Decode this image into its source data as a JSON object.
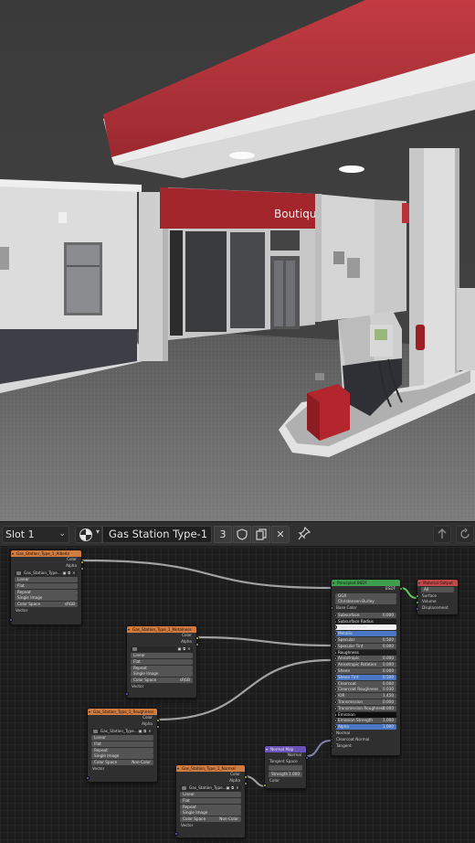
{
  "header": {
    "slot_label": "Slot 1",
    "material_name": "Gas Station Type-1",
    "user_count": "3",
    "chevron": "⌄",
    "browse_chevron": "▾",
    "icons": {
      "material_ball": "material-ball-icon",
      "fake_user": "shield-icon",
      "duplicate": "duplicate-icon",
      "unlink": "close-icon",
      "pin": "pin-icon",
      "parent": "arrow-up-icon",
      "snap": "refresh-icon"
    },
    "unlink_glyph": "✕",
    "pin_glyph": "📌"
  },
  "viewport": {
    "sign_text": "Boutique"
  },
  "nodes": {
    "tex1": {
      "title": "Gas_Station_Type_1_Albedo",
      "image": "Gas_Station_Type...",
      "outputs": [
        "Color",
        "Alpha"
      ],
      "fields": [
        "Linear",
        "Flat",
        "Repeat",
        "Single Image"
      ],
      "colorspace_label": "Color Space",
      "colorspace_value": "sRGB",
      "vector": "Vector"
    },
    "tex2": {
      "title": "Gas_Station_Type_1_Metalness",
      "outputs": [
        "Color",
        "Alpha"
      ],
      "fields": [
        "Linear",
        "Flat",
        "Repeat",
        "Single Image"
      ],
      "colorspace_label": "Color Space",
      "colorspace_value": "sRGB",
      "vector": "Vector"
    },
    "tex3": {
      "title": "Gas_Station_Type_1_Roughness",
      "image": "Gas_Station_Type...",
      "outputs": [
        "Color",
        "Alpha"
      ],
      "fields": [
        "Linear",
        "Flat",
        "Repeat",
        "Single Image"
      ],
      "colorspace_label": "Color Space",
      "colorspace_value": "Non-Color",
      "vector": "Vector"
    },
    "tex4": {
      "title": "Gas_Station_Type_1_Normal",
      "image": "Gas_Station_Type...",
      "outputs": [
        "Color",
        "Alpha"
      ],
      "fields": [
        "Linear",
        "Flat",
        "Repeat",
        "Single Image"
      ],
      "colorspace_label": "Color Space",
      "colorspace_value": "Non-Color",
      "vector": "Vector"
    },
    "normalmap": {
      "title": "Normal Map",
      "output": "Normal",
      "space": "Tangent Space",
      "strength_label": "Strength",
      "strength_value": "1.000",
      "color": "Color"
    },
    "bsdf": {
      "title": "Principled BSDF",
      "output": "BSDF",
      "distribution": "GGX",
      "subsurface_method": "Christensen-Burley",
      "rows": [
        {
          "label": "Base Color",
          "value": ""
        },
        {
          "label": "Subsurface",
          "value": "0.000"
        },
        {
          "label": "Subsurface Radius",
          "value": ""
        },
        {
          "label": "Subsurface Col",
          "value": ""
        },
        {
          "label": "Metallic",
          "value": ""
        },
        {
          "label": "Specular",
          "value": "0.500"
        },
        {
          "label": "Specular Tint",
          "value": "0.000"
        },
        {
          "label": "Roughness",
          "value": ""
        },
        {
          "label": "Anisotropic",
          "value": "0.000"
        },
        {
          "label": "Anisotropic Rotation",
          "value": "0.000"
        },
        {
          "label": "Sheen",
          "value": "0.000"
        },
        {
          "label": "Sheen Tint",
          "value": "0.500"
        },
        {
          "label": "Clearcoat",
          "value": "0.000"
        },
        {
          "label": "Clearcoat Roughness",
          "value": "0.030"
        },
        {
          "label": "IOR",
          "value": "1.450"
        },
        {
          "label": "Transmission",
          "value": "0.000"
        },
        {
          "label": "Transmission Roughness",
          "value": "0.000"
        },
        {
          "label": "Emission",
          "value": ""
        },
        {
          "label": "Emission Strength",
          "value": "1.000"
        },
        {
          "label": "Alpha",
          "value": "1.000"
        },
        {
          "label": "Normal",
          "value": ""
        },
        {
          "label": "Clearcoat Normal",
          "value": ""
        },
        {
          "label": "Tangent",
          "value": ""
        }
      ]
    },
    "output": {
      "title": "Material Output",
      "target": "All",
      "inputs": [
        "Surface",
        "Volume",
        "Displacement"
      ]
    }
  },
  "colors": {
    "texture_header": "#d17b3f",
    "bsdf_header": "#3d9e4d",
    "output_header": "#c04a4a",
    "vector_header": "#6a52b8",
    "canopy_red": "#b8323a"
  }
}
